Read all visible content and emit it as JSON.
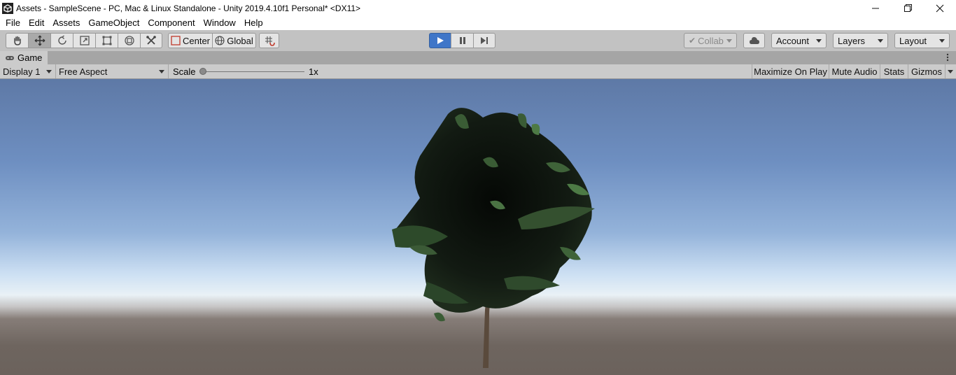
{
  "window": {
    "title": "Assets - SampleScene - PC, Mac & Linux Standalone - Unity 2019.4.10f1 Personal* <DX11>",
    "icon": "unity-logo-icon",
    "controls": [
      "minimize-icon",
      "restore-icon",
      "close-icon"
    ]
  },
  "menu": {
    "items": [
      "File",
      "Edit",
      "Assets",
      "GameObject",
      "Component",
      "Window",
      "Help"
    ]
  },
  "toolbar": {
    "transform_tools": [
      "hand-tool-icon",
      "move-tool-icon",
      "rotate-tool-icon",
      "scale-tool-icon",
      "rect-tool-icon",
      "transform-tool-icon",
      "custom-tool-icon"
    ],
    "active_tool": "move-tool-icon",
    "pivot_label": "Center",
    "space_label": "Global",
    "snap_icon": "grid-snap-icon",
    "play_controls": [
      "play-icon",
      "pause-icon",
      "step-icon"
    ],
    "playing": true,
    "collab_label": "Collab",
    "cloud_icon": "cloud-icon",
    "account_label": "Account",
    "layers_label": "Layers",
    "layout_label": "Layout",
    "accent_color": "#3f76c8"
  },
  "game_tab": {
    "label": "Game",
    "icon": "gamepad-icon",
    "menu_icon": "kebab-menu-icon"
  },
  "game_bar": {
    "display": "Display 1",
    "aspect": "Free Aspect",
    "scale_label": "Scale",
    "scale_value": "1x",
    "scale_slider_fraction": 0,
    "maximize_label": "Maximize On Play",
    "mute_label": "Mute Audio",
    "stats_label": "Stats",
    "gizmos_label": "Gizmos"
  },
  "scene": {
    "sky_top_color": "#5e79a6",
    "horizon_color": "#e9f1f6",
    "ground_color": "#6b625c",
    "tree_leaf_color": "#2d3f2a",
    "tree_trunk_color": "#5a4a3c"
  }
}
